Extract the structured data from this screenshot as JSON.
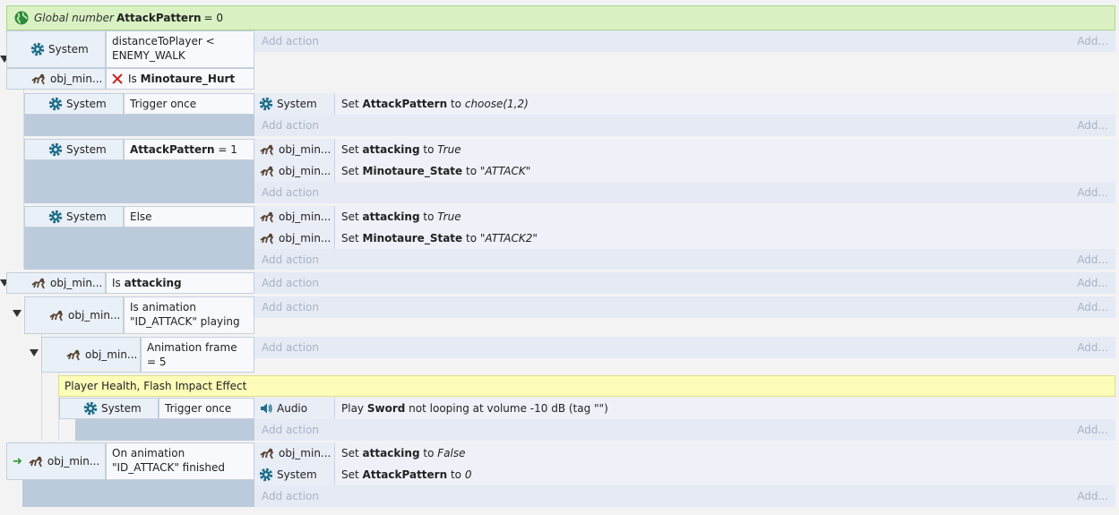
{
  "global_var": {
    "prefix": "Global number",
    "name": "AttackPattern",
    "suffix": "= 0"
  },
  "labels": {
    "system": "System",
    "obj": "obj_min...",
    "audio": "Audio",
    "add_action": "Add action",
    "add_short": "Add..."
  },
  "ev1": {
    "cond1": "distanceToPlayer < ENEMY_WALK",
    "cond2_prefix": "Is",
    "cond2_bold": "Minotaure_Hurt"
  },
  "ev1a": {
    "cond": "Trigger once",
    "act_prefix": "Set",
    "act_bold": "AttackPattern",
    "act_mid": "to",
    "act_italic": "choose(1,2)"
  },
  "ev1b": {
    "cond_bold": "AttackPattern",
    "cond_rest": "= 1",
    "act1_bold": "attacking",
    "act1_italic": "True",
    "act2_bold": "Minotaure_State",
    "act2_italic": "\"ATTACK\""
  },
  "ev1c": {
    "cond": "Else",
    "act1_bold": "attacking",
    "act1_italic": "True",
    "act2_bold": "Minotaure_State",
    "act2_italic": "\"ATTACK2\""
  },
  "ev2": {
    "cond_prefix": "Is",
    "cond_bold": "attacking"
  },
  "ev2a": {
    "cond": "Is animation \"ID_ATTACK\" playing"
  },
  "ev2b": {
    "cond": "Animation frame = 5"
  },
  "comment": "Player Health, Flash Impact Effect",
  "ev2c": {
    "cond": "Trigger once",
    "act_prefix": "Play",
    "act_bold": "Sword",
    "act_rest": "not looping at volume -10 dB (tag \"\")"
  },
  "ev3": {
    "cond": "On animation \"ID_ATTACK\" finished",
    "act1_bold": "attacking",
    "act1_italic": "False",
    "act2_bold": "AttackPattern",
    "act2_italic": "0"
  },
  "words": {
    "set": "Set",
    "to": "to"
  },
  "colors": {
    "gear": "#1f6f8b",
    "x_mark": "#d22020",
    "arrow": "#2a9a2a"
  }
}
